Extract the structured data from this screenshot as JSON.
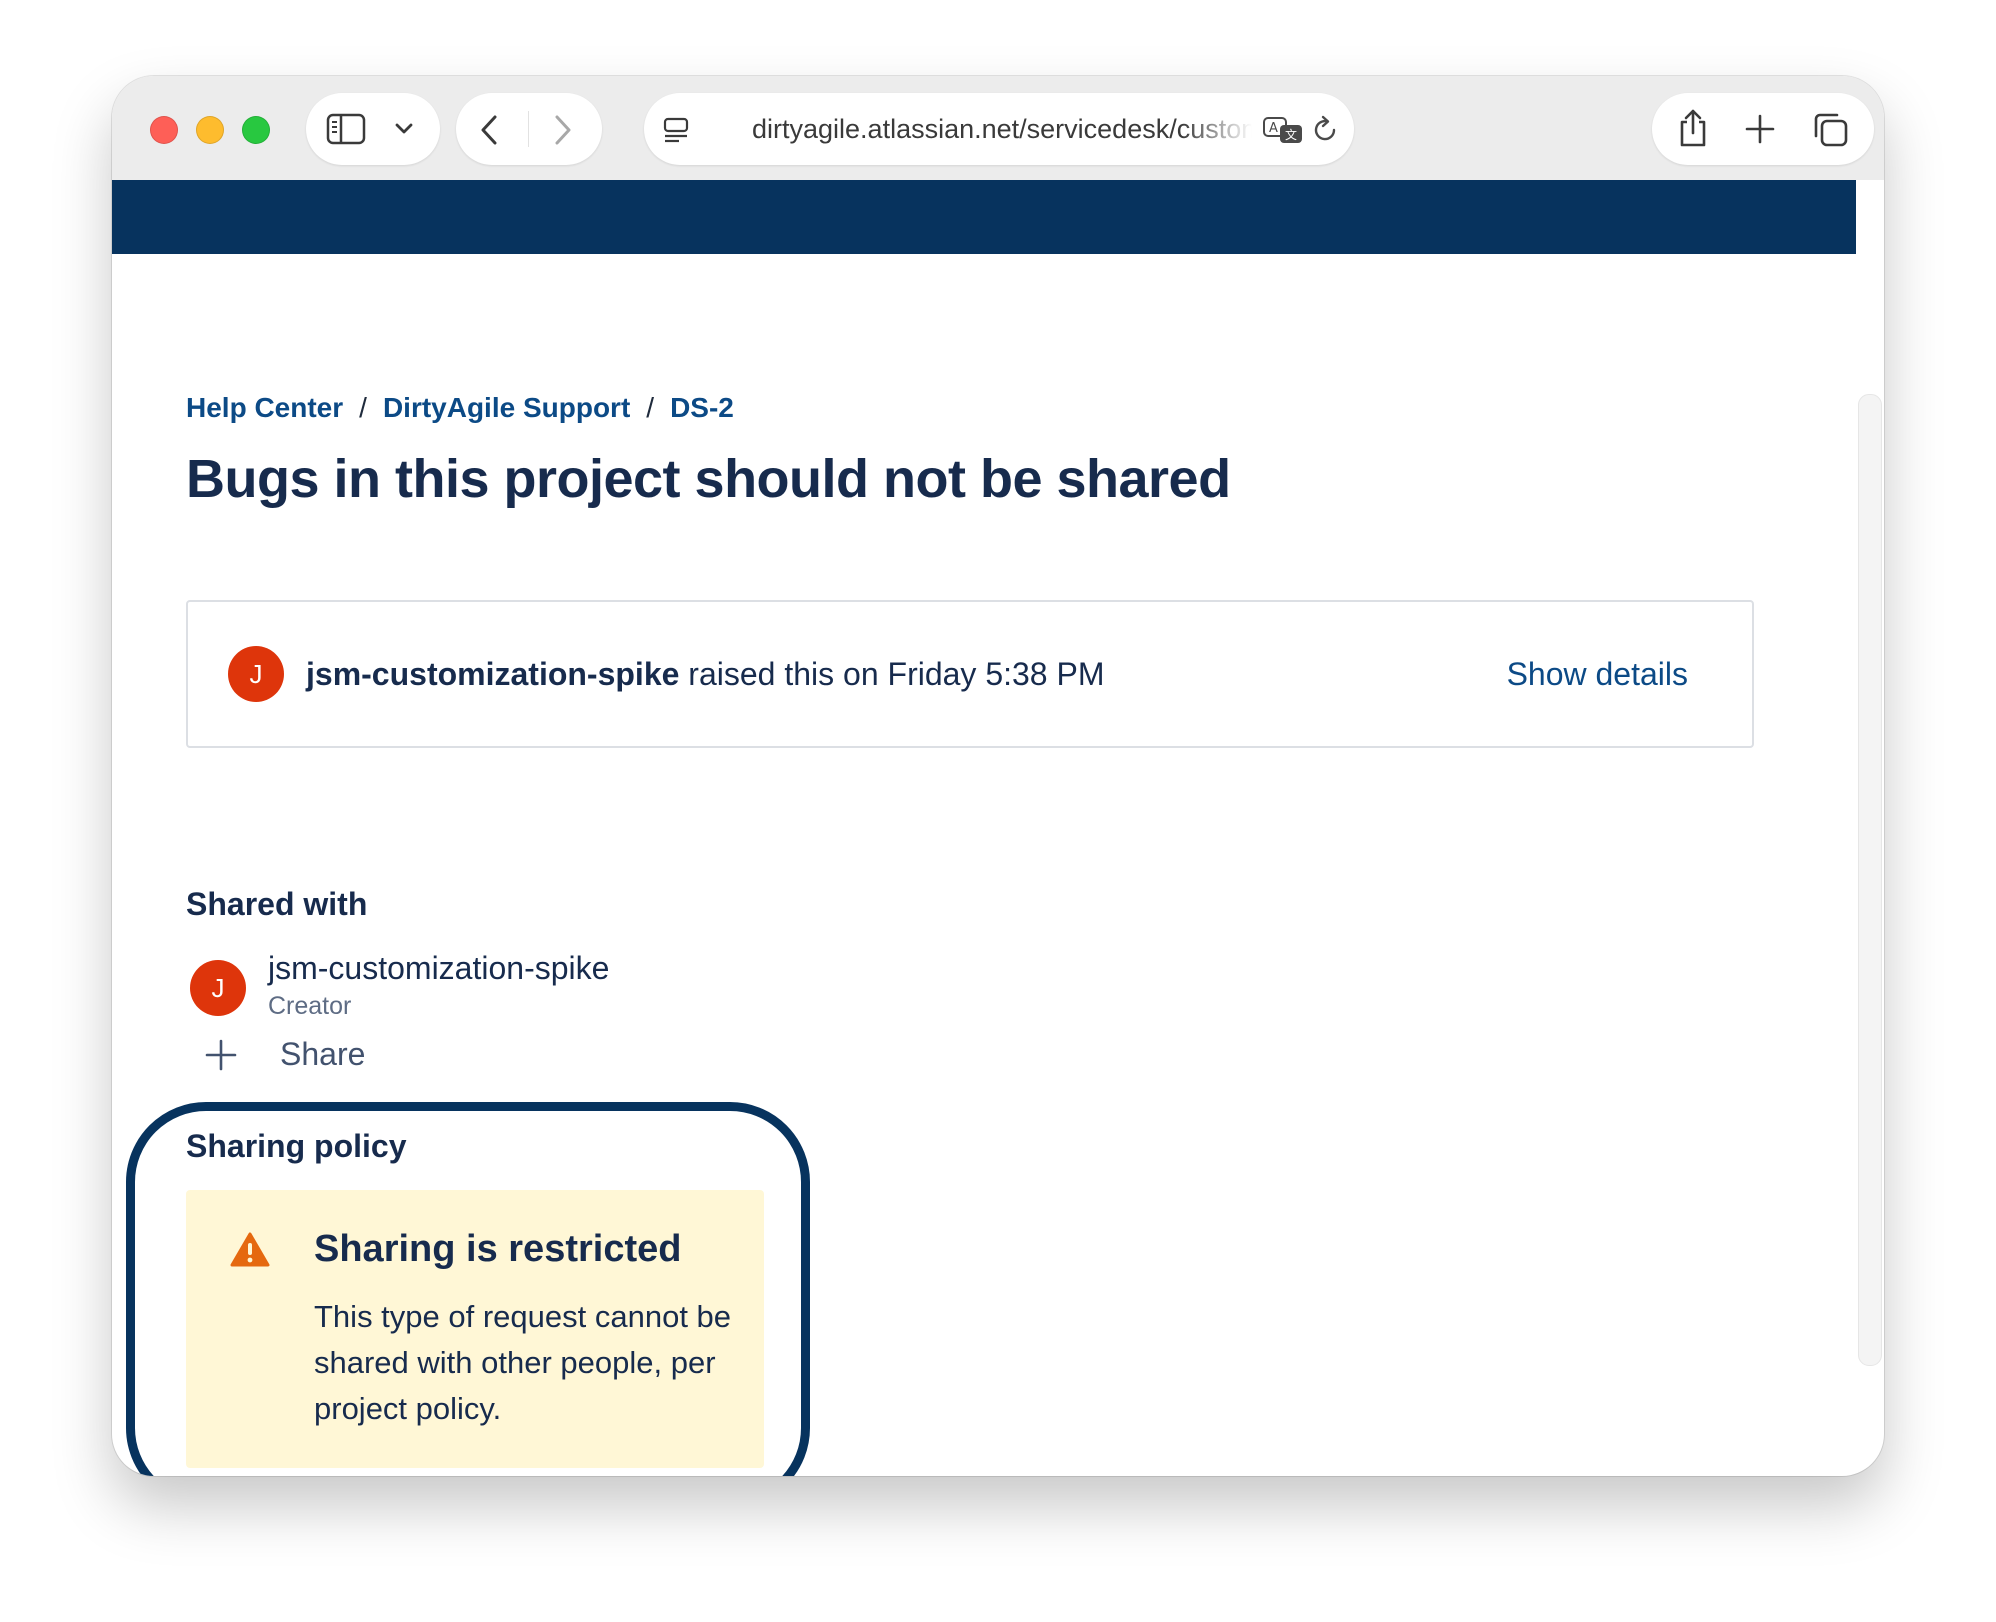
{
  "browser": {
    "url": "dirtyagile.atlassian.net/servicedesk/customer"
  },
  "breadcrumb": {
    "items": [
      "Help Center",
      "DirtyAgile Support",
      "DS-2"
    ],
    "separator": "/"
  },
  "request": {
    "title": "Bugs in this project should not be shared",
    "reporter": "jsm-customization-spike",
    "raised_text": "raised this on Friday 5:38 PM",
    "avatar_initial": "J",
    "show_details_label": "Show details"
  },
  "shared_with": {
    "heading": "Shared with",
    "participants": [
      {
        "initial": "J",
        "name": "jsm-customization-spike",
        "role": "Creator"
      }
    ],
    "share_label": "Share"
  },
  "sharing_policy": {
    "heading": "Sharing policy",
    "warning_title": "Sharing is restricted",
    "warning_body": "This type of request cannot be shared with other people, per project policy."
  },
  "icons": {
    "sidebar": "sidebar-icon",
    "chevron": "chevron-down-icon",
    "back": "back-icon",
    "forward": "forward-icon",
    "page_menu": "page-menu-icon",
    "translate": "translate-icon",
    "reload": "reload-icon",
    "share": "share-icon",
    "new_tab": "plus-icon",
    "tabs": "tabs-overview-icon",
    "add_participant": "plus-icon",
    "warning": "warning-icon"
  },
  "colors": {
    "navbar": "#07335e",
    "link": "#0c4a86",
    "avatar": "#de350b",
    "warning_bg": "#fff7d6",
    "warning_icon": "#e56910",
    "highlight_ring": "#07335e"
  }
}
